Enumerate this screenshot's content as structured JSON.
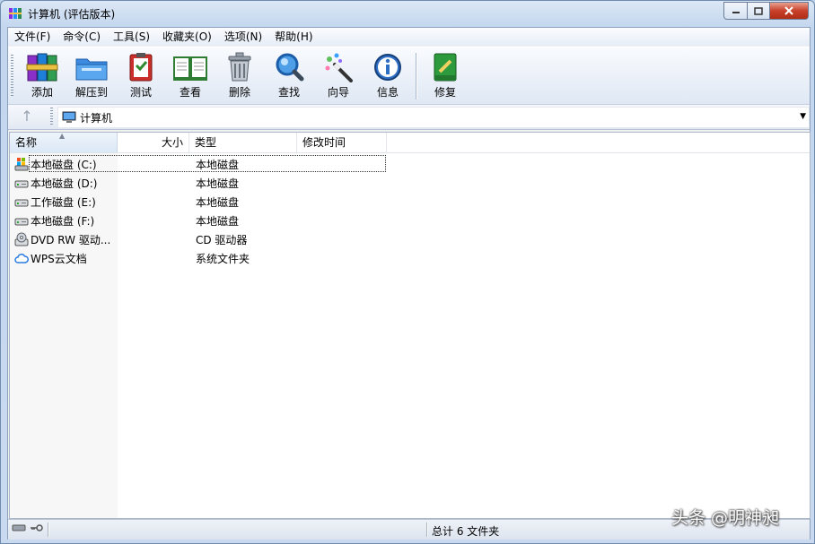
{
  "window": {
    "title": "计算机 (评估版本)"
  },
  "menu": [
    "文件(F)",
    "命令(C)",
    "工具(S)",
    "收藏夹(O)",
    "选项(N)",
    "帮助(H)"
  ],
  "toolbar": [
    {
      "label": "添加",
      "icon": "archive-books-icon"
    },
    {
      "label": "解压到",
      "icon": "folder-extract-icon"
    },
    {
      "label": "测试",
      "icon": "clipboard-check-icon"
    },
    {
      "label": "查看",
      "icon": "open-book-icon"
    },
    {
      "label": "删除",
      "icon": "trash-can-icon"
    },
    {
      "label": "查找",
      "icon": "magnifier-icon"
    },
    {
      "label": "向导",
      "icon": "magic-wand-icon"
    },
    {
      "label": "信息",
      "icon": "info-icon"
    },
    {
      "label": "修复",
      "icon": "repair-kit-icon"
    }
  ],
  "address": {
    "path": "计算机"
  },
  "columns": {
    "name": "名称",
    "size": "大小",
    "type": "类型",
    "modified": "修改时间"
  },
  "files": [
    {
      "name": "本地磁盘 (C:)",
      "type": "本地磁盘",
      "icon": "system-drive-icon"
    },
    {
      "name": "本地磁盘 (D:)",
      "type": "本地磁盘",
      "icon": "hard-drive-icon"
    },
    {
      "name": "工作磁盘 (E:)",
      "type": "本地磁盘",
      "icon": "hard-drive-icon"
    },
    {
      "name": "本地磁盘 (F:)",
      "type": "本地磁盘",
      "icon": "hard-drive-icon"
    },
    {
      "name": "DVD RW 驱动...",
      "type": "CD 驱动器",
      "icon": "dvd-drive-icon"
    },
    {
      "name": "WPS云文档",
      "type": "系统文件夹",
      "icon": "cloud-icon"
    }
  ],
  "status": {
    "summary": "总计 6 文件夹"
  },
  "watermark": "头条 @明神昶",
  "colors": {
    "title_bar": "#c3d6ee",
    "close_button": "#c8402a",
    "list_bg": "#ffffff"
  }
}
